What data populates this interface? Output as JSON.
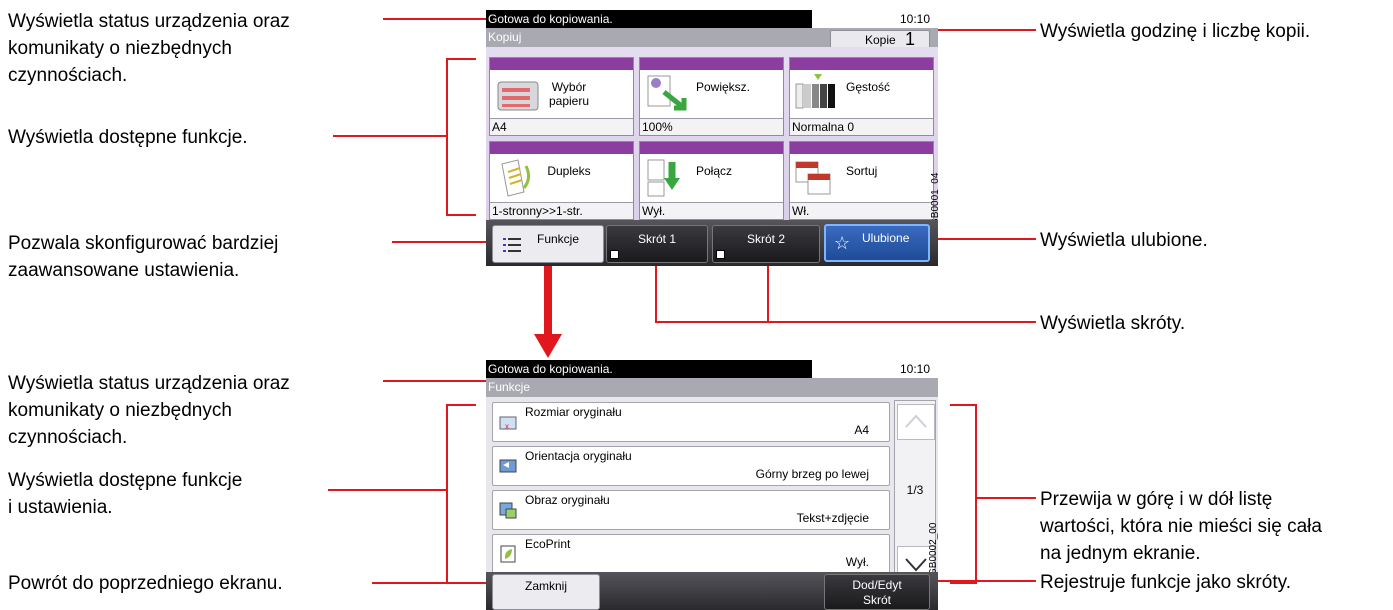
{
  "annotations": {
    "status_top": "Wyświetla status urządzenia oraz\nkomunikaty o niezbędnych\nczynnościach.",
    "functions_top": "Wyświetla dostępne funkcje.",
    "advanced": "Pozwala skonfigurować bardziej\nzaawansowane ustawienia.",
    "time_copies": "Wyświetla godzinę i liczbę kopii.",
    "favorites": "Wyświetla ulubione.",
    "shortcuts": "Wyświetla skróty.",
    "status_bottom": "Wyświetla status urządzenia oraz\nkomunikaty o niezbędnych\nczynnościach.",
    "functions_bottom": "Wyświetla dostępne funkcje\ni ustawienia.",
    "back": "Powrót do poprzedniego ekranu.",
    "scroll": "Przewija w górę i w dół listę\nwartości, która nie mieści się cała\nna jednym ekranie.",
    "register": "Rejestruje funkcje jako skróty."
  },
  "screen1": {
    "status": "Gotowa do kopiowania.",
    "time": "10:10",
    "title": "Kopiuj",
    "copies_label": "Kopie",
    "copies_value": "1",
    "code": "GB0001_04",
    "tiles": [
      {
        "label": "Wybór papieru",
        "value": "A4"
      },
      {
        "label": "Powiększ.",
        "value": "100%"
      },
      {
        "label": "Gęstość",
        "value": "Normalna 0"
      },
      {
        "label": "Dupleks",
        "value": "1-stronny>>1-str."
      },
      {
        "label": "Połącz",
        "value": "Wył."
      },
      {
        "label": "Sortuj",
        "value": "Wł."
      }
    ],
    "bottom": {
      "functions": "Funkcje",
      "shortcut1": "Skrót 1",
      "shortcut2": "Skrót 2",
      "favorites": "Ulubione"
    }
  },
  "screen2": {
    "status": "Gotowa do kopiowania.",
    "time": "10:10",
    "title": "Funkcje",
    "code": "GB0002_00",
    "rows": [
      {
        "label": "Rozmiar oryginału",
        "value": "A4"
      },
      {
        "label": "Orientacja oryginału",
        "value": "Górny brzeg po lewej"
      },
      {
        "label": "Obraz oryginału",
        "value": "Tekst+zdjęcie"
      },
      {
        "label": "EcoPrint",
        "value": "Wył."
      }
    ],
    "page": "1/3",
    "close": "Zamknij",
    "add_edit_line1": "Dod/Edyt",
    "add_edit_line2": "Skrót"
  },
  "colors": {
    "accent": "#e1171e",
    "tile_header": "#8b3ea0",
    "favorite": "#2a5cb0"
  },
  "icons": [
    "functions-list-icon",
    "star-icon",
    "shortcut-icon",
    "chevron-up-icon",
    "chevron-down-icon"
  ]
}
